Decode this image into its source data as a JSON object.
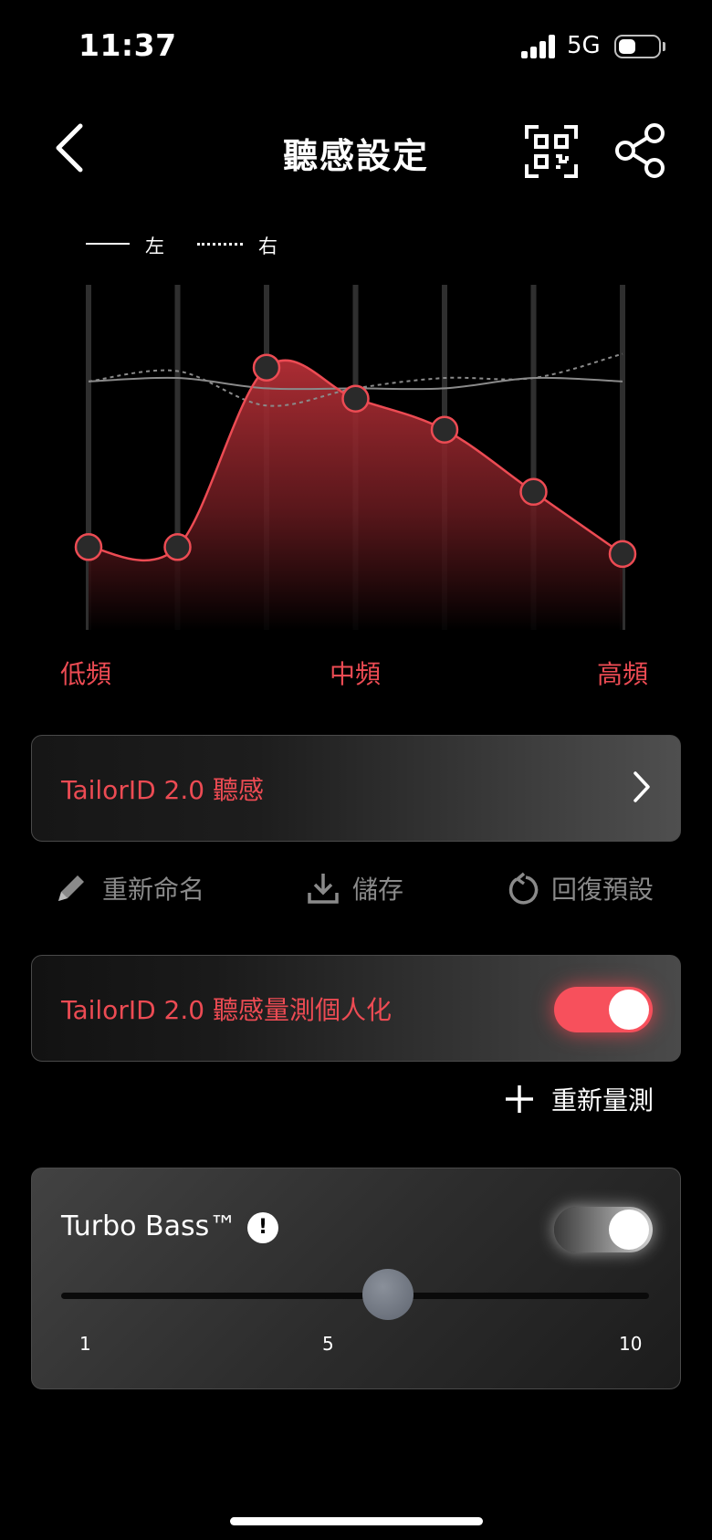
{
  "status_bar": {
    "time": "11:37",
    "network": "5G",
    "battery_percent": 45
  },
  "header": {
    "title": "聽感設定",
    "back_icon": "chevron-left-icon",
    "qr_icon": "qr-code-icon",
    "share_icon": "share-icon"
  },
  "legend": {
    "left": "左",
    "right": "右"
  },
  "eq_chart": {
    "bands": [
      "低頻",
      "中頻",
      "高頻"
    ],
    "band_count": 7,
    "tailor_levels": [
      0.24,
      0.24,
      0.76,
      0.67,
      0.58,
      0.4,
      0.22
    ],
    "left_levels": [
      0.72,
      0.73,
      0.7,
      0.7,
      0.7,
      0.73,
      0.72
    ],
    "right_levels": [
      0.72,
      0.75,
      0.65,
      0.7,
      0.73,
      0.73,
      0.8
    ],
    "accent_color": "#ec4b53"
  },
  "profile_card": {
    "label": "TailorID 2.0 聽感",
    "chevron_icon": "chevron-right-icon"
  },
  "actions": {
    "rename": "重新命名",
    "save": "儲存",
    "reset": "回復預設"
  },
  "personalize": {
    "label": "TailorID 2.0 聽感量測個人化",
    "enabled": true
  },
  "remeasure": {
    "label": "重新量測"
  },
  "turbo_bass": {
    "title": "Turbo Bass™",
    "info_icon": "exclamation-icon",
    "info_glyph": "!",
    "enabled": true,
    "slider": {
      "min_label": "1",
      "mid_label": "5",
      "max_label": "10",
      "value": 6
    }
  }
}
